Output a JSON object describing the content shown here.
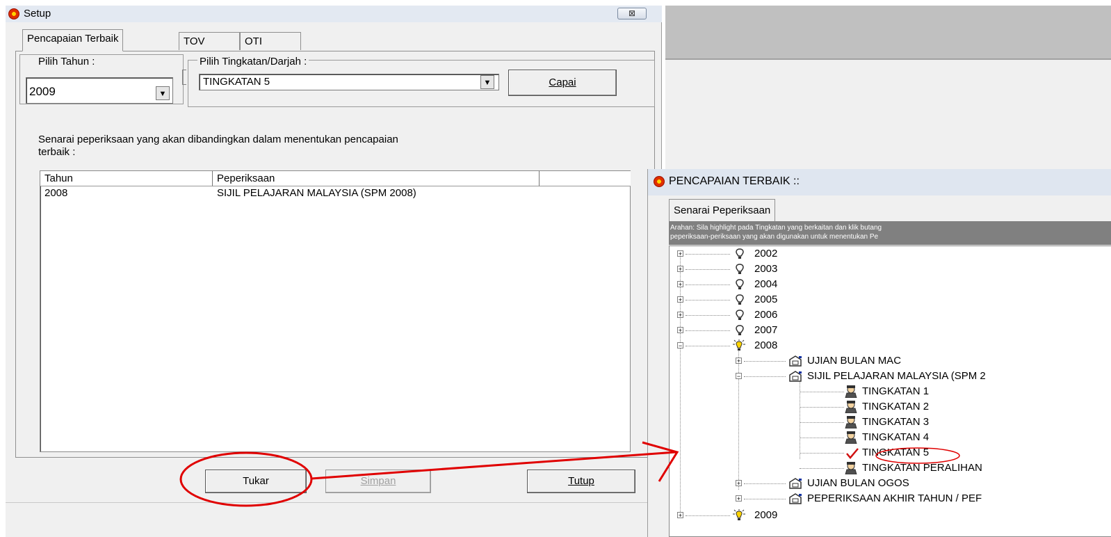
{
  "setup": {
    "title": "Setup",
    "close_glyph": "⊠",
    "tabs": [
      {
        "label": "Pencapaian Terbaik"
      },
      {
        "label": "TOV"
      },
      {
        "label": "OTI"
      }
    ],
    "pilih_tahun_label": "Pilih Tahun :",
    "pilih_tahun_value": "2009",
    "pilih_tingkatan_label": "Pilih Tingkatan/Darjah :",
    "pilih_tingkatan_value": "TINGKATAN 5",
    "capai_label": "Capai",
    "description_line1": "Senarai peperiksaan yang akan dibandingkan dalam menentukan pencapaian",
    "description_line2": "terbaik :",
    "list": {
      "columns": [
        "Tahun",
        "Peperiksaan"
      ],
      "rows": [
        {
          "tahun": "2008",
          "peperiksaan": "SIJIL PELAJARAN MALAYSIA (SPM 2008)"
        }
      ]
    },
    "buttons": {
      "tukar": "Tukar",
      "simpan": "Simpan",
      "tutup": "Tutup"
    }
  },
  "pencapaian": {
    "title": "PENCAPAIAN TERBAIK ::",
    "tab": "Senarai Peperiksaan",
    "arahan_line1": "Arahan: Sila highlight pada Tingkatan yang berkaitan dan klik butang",
    "arahan_line2": "peperiksaan-periksaan yang akan digunakan untuk menentukan Pe",
    "tree": {
      "years": [
        "2002",
        "2003",
        "2004",
        "2005",
        "2006",
        "2007",
        "2008",
        "2009"
      ],
      "exams_2008": [
        "UJIAN BULAN MAC",
        "SIJIL PELAJARAN MALAYSIA (SPM 2",
        "UJIAN BULAN OGOS",
        "PEPERIKSAAN AKHIR TAHUN / PEF"
      ],
      "forms": [
        "TINGKATAN 1",
        "TINGKATAN 2",
        "TINGKATAN 3",
        "TINGKATAN 4",
        "TINGKATAN 5",
        "TINGKATAN PERALIHAN"
      ]
    }
  },
  "colors": {
    "annotation": "#e00000",
    "dark_bulb": "#303030",
    "lit_bulb": "#ffd400"
  },
  "icons": {
    "app": "app-icon",
    "close": "close-icon",
    "dropdown": "chevron-down-icon",
    "expand": "plus-box-icon",
    "collapse": "minus-box-icon",
    "year": "bulb-icon",
    "exam": "folder-icon",
    "form": "student-icon",
    "selected": "checkmark-icon"
  }
}
